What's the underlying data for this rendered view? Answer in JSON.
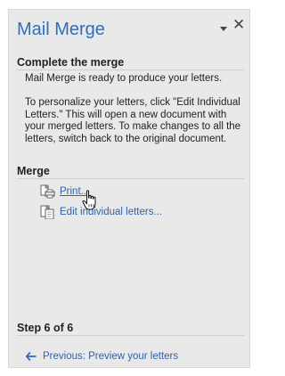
{
  "pane": {
    "title": "Mail Merge",
    "dropdown_icon": "triangle-down-icon",
    "close_icon": "close-icon"
  },
  "complete": {
    "heading": "Complete the merge",
    "ready_text": "Mail Merge is ready to produce your letters.",
    "personalize_text": "To personalize your letters, click \"Edit Individual Letters.\" This will open a new document with your merged letters. To make changes to all the letters, switch back to the original document."
  },
  "merge": {
    "heading": "Merge",
    "actions": [
      {
        "label": "Print...",
        "icon": "print-icon"
      },
      {
        "label": "Edit individual letters...",
        "icon": "edit-letters-icon"
      }
    ]
  },
  "footer": {
    "step": "Step 6 of 6",
    "previous_label": "Previous: Preview your letters",
    "previous_icon": "arrow-left-icon"
  },
  "colors": {
    "accent": "#2e6fbd",
    "link": "#2e63a8",
    "pane_bg": "#e9e9e9"
  }
}
